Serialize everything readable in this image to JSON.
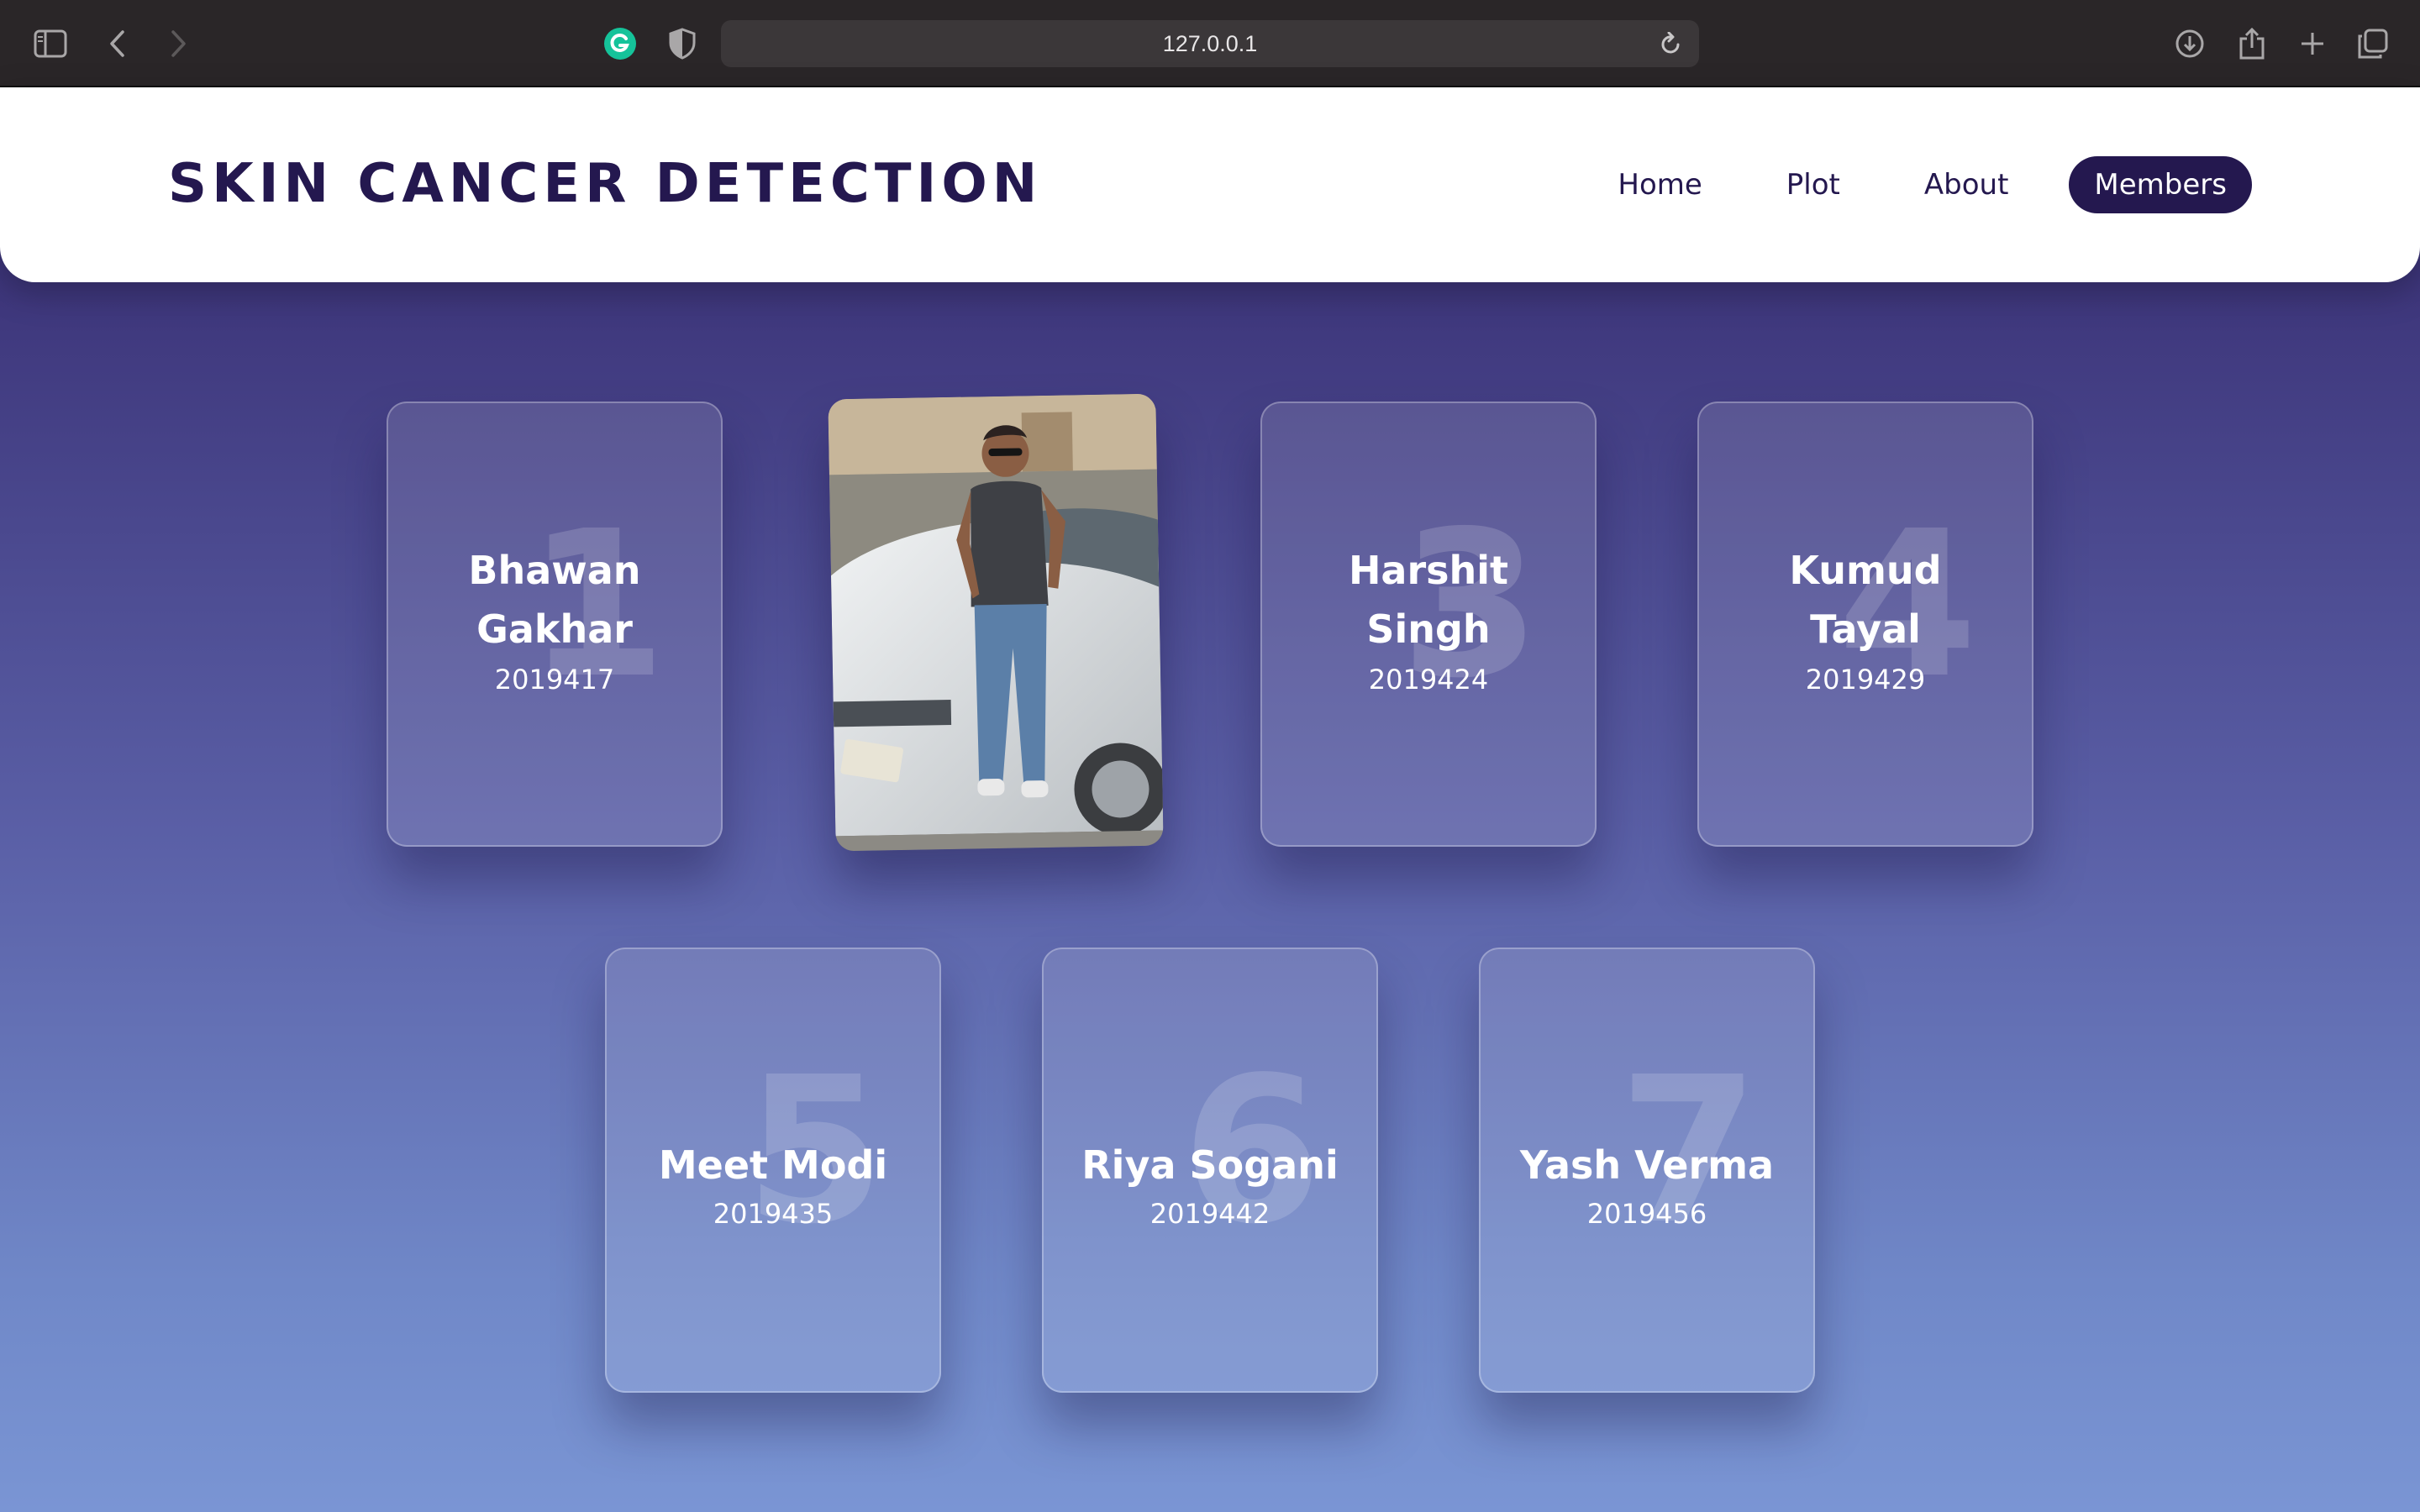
{
  "browser": {
    "url": "127.0.0.1"
  },
  "header": {
    "brand": "SKIN CANCER DETECTION",
    "nav": [
      "Home",
      "Plot",
      "About",
      "Members"
    ]
  },
  "members": [
    {
      "number": "1",
      "name": "Bhawan Gakhar",
      "roll": "2019417"
    },
    {
      "number": "3",
      "name": "Harshit Singh",
      "roll": "2019424"
    },
    {
      "number": "4",
      "name": "Kumud Tayal",
      "roll": "2019429"
    },
    {
      "number": "5",
      "name": "Meet Modi",
      "roll": "2019435"
    },
    {
      "number": "6",
      "name": "Riya Sogani",
      "roll": "2019442"
    },
    {
      "number": "7",
      "name": "Yash Verma",
      "roll": "2019456"
    }
  ],
  "photo_card": {
    "icon": "member-photo-image"
  }
}
